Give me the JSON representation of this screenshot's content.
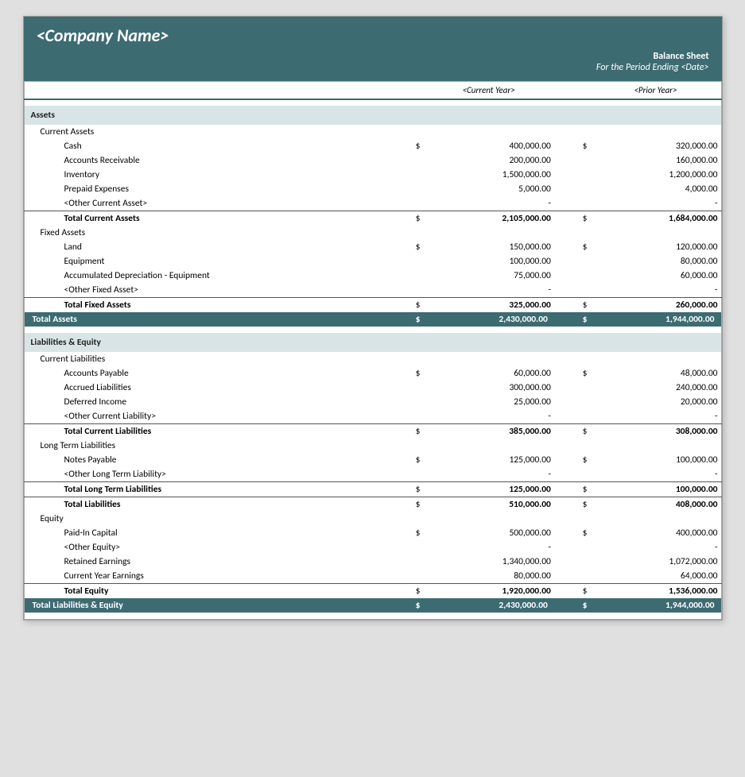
{
  "header": {
    "company_name": "<Company Name>",
    "report_title": "Balance Sheet",
    "report_subtitle": "For the Period Ending <Date>",
    "col_cy": "<Current Year>",
    "col_py": "<Prior Year>"
  },
  "assets": {
    "section_label": "Assets",
    "current_assets": {
      "label": "Current Assets",
      "items": [
        {
          "label": "Cash",
          "sign_cy": "$",
          "cy": "400,000.00",
          "sign_py": "$",
          "py": "320,000.00"
        },
        {
          "label": "Accounts Receivable",
          "sign_cy": "",
          "cy": "200,000.00",
          "sign_py": "",
          "py": "160,000.00"
        },
        {
          "label": "Inventory",
          "sign_cy": "",
          "cy": "1,500,000.00",
          "sign_py": "",
          "py": "1,200,000.00"
        },
        {
          "label": "Prepaid Expenses",
          "sign_cy": "",
          "cy": "5,000.00",
          "sign_py": "",
          "py": "4,000.00"
        },
        {
          "label": "<Other Current Asset>",
          "sign_cy": "",
          "cy": "-",
          "sign_py": "",
          "py": "-"
        }
      ],
      "total_label": "Total Current Assets",
      "total_sign_cy": "$",
      "total_cy": "2,105,000.00",
      "total_sign_py": "$",
      "total_py": "1,684,000.00"
    },
    "fixed_assets": {
      "label": "Fixed Assets",
      "items": [
        {
          "label": "Land",
          "sign_cy": "$",
          "cy": "150,000.00",
          "sign_py": "$",
          "py": "120,000.00"
        },
        {
          "label": "Equipment",
          "sign_cy": "",
          "cy": "100,000.00",
          "sign_py": "",
          "py": "80,000.00"
        },
        {
          "label": "Accumulated Depreciation - Equipment",
          "sign_cy": "",
          "cy": "75,000.00",
          "sign_py": "",
          "py": "60,000.00"
        },
        {
          "label": "<Other Fixed Asset>",
          "sign_cy": "",
          "cy": "-",
          "sign_py": "",
          "py": "-"
        }
      ],
      "total_label": "Total Fixed Assets",
      "total_sign_cy": "$",
      "total_cy": "325,000.00",
      "total_sign_py": "$",
      "total_py": "260,000.00"
    },
    "grand_total_label": "Total Assets",
    "grand_total_sign_cy": "$",
    "grand_total_cy": "2,430,000.00",
    "grand_total_sign_py": "$",
    "grand_total_py": "1,944,000.00"
  },
  "liabilities_equity": {
    "section_label": "Liabilities & Equity",
    "current_liabilities": {
      "label": "Current Liabilities",
      "items": [
        {
          "label": "Accounts Payable",
          "sign_cy": "$",
          "cy": "60,000.00",
          "sign_py": "$",
          "py": "48,000.00"
        },
        {
          "label": "Accrued Liabilities",
          "sign_cy": "",
          "cy": "300,000.00",
          "sign_py": "",
          "py": "240,000.00"
        },
        {
          "label": "Deferred Income",
          "sign_cy": "",
          "cy": "25,000.00",
          "sign_py": "",
          "py": "20,000.00"
        },
        {
          "label": "<Other Current Liability>",
          "sign_cy": "",
          "cy": "-",
          "sign_py": "",
          "py": "-"
        }
      ],
      "total_label": "Total Current Liabilities",
      "total_sign_cy": "$",
      "total_cy": "385,000.00",
      "total_sign_py": "$",
      "total_py": "308,000.00"
    },
    "long_term_liabilities": {
      "label": "Long Term Liabilities",
      "items": [
        {
          "label": "Notes Payable",
          "sign_cy": "$",
          "cy": "125,000.00",
          "sign_py": "$",
          "py": "100,000.00"
        },
        {
          "label": "<Other Long Term Liability>",
          "sign_cy": "",
          "cy": "-",
          "sign_py": "",
          "py": "-"
        }
      ],
      "total_label": "Total Long Term Liabilities",
      "total_sign_cy": "$",
      "total_cy": "125,000.00",
      "total_sign_py": "$",
      "total_py": "100,000.00",
      "liabilities_total_label": "Total Liabilities",
      "liabilities_total_sign_cy": "$",
      "liabilities_total_cy": "510,000.00",
      "liabilities_total_sign_py": "$",
      "liabilities_total_py": "408,000.00"
    },
    "equity": {
      "label": "Equity",
      "items": [
        {
          "label": "Paid-In Capital",
          "sign_cy": "$",
          "cy": "500,000.00",
          "sign_py": "$",
          "py": "400,000.00"
        },
        {
          "label": "<Other Equity>",
          "sign_cy": "",
          "cy": "-",
          "sign_py": "",
          "py": "-"
        },
        {
          "label": "Retained Earnings",
          "sign_cy": "",
          "cy": "1,340,000.00",
          "sign_py": "",
          "py": "1,072,000.00"
        },
        {
          "label": "Current Year Earnings",
          "sign_cy": "",
          "cy": "80,000.00",
          "sign_py": "",
          "py": "64,000.00"
        }
      ],
      "total_label": "Total Equity",
      "total_sign_cy": "$",
      "total_cy": "1,920,000.00",
      "total_sign_py": "$",
      "total_py": "1,536,000.00"
    },
    "grand_total_label": "Total Liabilities & Equity",
    "grand_total_sign_cy": "$",
    "grand_total_cy": "2,430,000.00",
    "grand_total_sign_py": "$",
    "grand_total_py": "1,944,000.00"
  }
}
